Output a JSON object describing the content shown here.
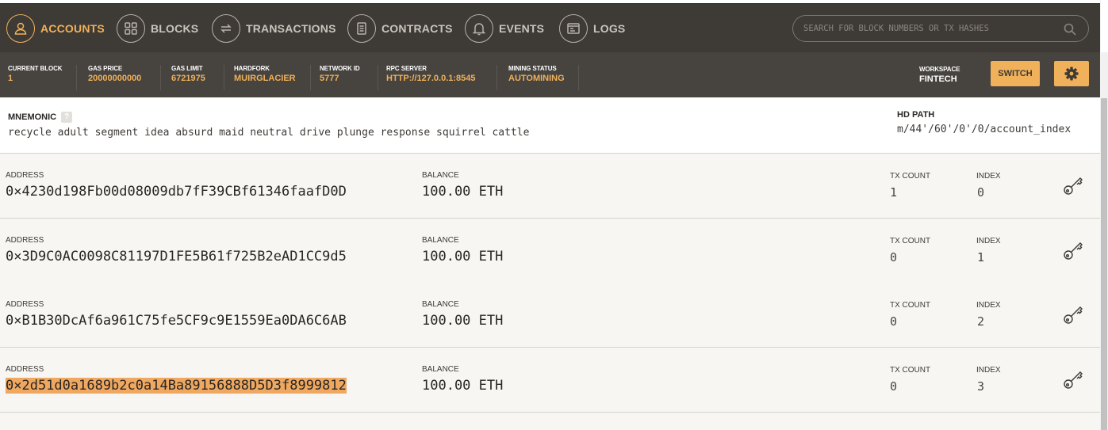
{
  "nav": {
    "accounts": "ACCOUNTS",
    "blocks": "BLOCKS",
    "transactions": "TRANSACTIONS",
    "contracts": "CONTRACTS",
    "events": "EVENTS",
    "logs": "LOGS",
    "search_placeholder": "SEARCH FOR BLOCK NUMBERS OR TX HASHES",
    "active": "accounts",
    "accent": "#f0b15a"
  },
  "status": {
    "current_block_label": "CURRENT BLOCK",
    "current_block": "1",
    "gas_price_label": "GAS PRICE",
    "gas_price": "20000000000",
    "gas_limit_label": "GAS LIMIT",
    "gas_limit": "6721975",
    "hardfork_label": "HARDFORK",
    "hardfork": "MUIRGLACIER",
    "network_id_label": "NETWORK ID",
    "network_id": "5777",
    "rpc_label": "RPC SERVER",
    "rpc": "HTTP://127.0.0.1:8545",
    "mining_label": "MINING STATUS",
    "mining": "AUTOMINING",
    "workspace_label": "WORKSPACE",
    "workspace": "FINTECH",
    "switch_label": "SWITCH"
  },
  "mnemonic": {
    "label": "MNEMONIC",
    "help": "?",
    "words": "recycle adult segment idea absurd maid neutral drive plunge response squirrel cattle",
    "hd_label": "HD PATH",
    "hd_path": "m/44'/60'/0'/0/account_index"
  },
  "accounts": [
    {
      "address_label": "ADDRESS",
      "address": "0×4230d198Fb00d08009db7fF39CBf61346faafD0D",
      "balance_label": "BALANCE",
      "balance": "100.00 ETH",
      "tx_label": "TX COUNT",
      "tx_count": "1",
      "index_label": "INDEX",
      "index": "0"
    },
    {
      "address_label": "ADDRESS",
      "address": "0×3D9C0AC0098C81197D1FE5B61f725B2eAD1CC9d5",
      "balance_label": "BALANCE",
      "balance": "100.00 ETH",
      "tx_label": "TX COUNT",
      "tx_count": "0",
      "index_label": "INDEX",
      "index": "1"
    },
    {
      "address_label": "ADDRESS",
      "address": "0×B1B30DcAf6a961C75fe5CF9c9E1559Ea0DA6C6AB",
      "balance_label": "BALANCE",
      "balance": "100.00 ETH",
      "tx_label": "TX COUNT",
      "tx_count": "0",
      "index_label": "INDEX",
      "index": "2"
    },
    {
      "address_label": "ADDRESS",
      "address": "0×2d51d0a1689b2c0a14Ba89156888D5D3f8999812",
      "balance_label": "BALANCE",
      "balance": "100.00 ETH",
      "tx_label": "TX COUNT",
      "tx_count": "0",
      "index_label": "INDEX",
      "index": "3"
    }
  ]
}
